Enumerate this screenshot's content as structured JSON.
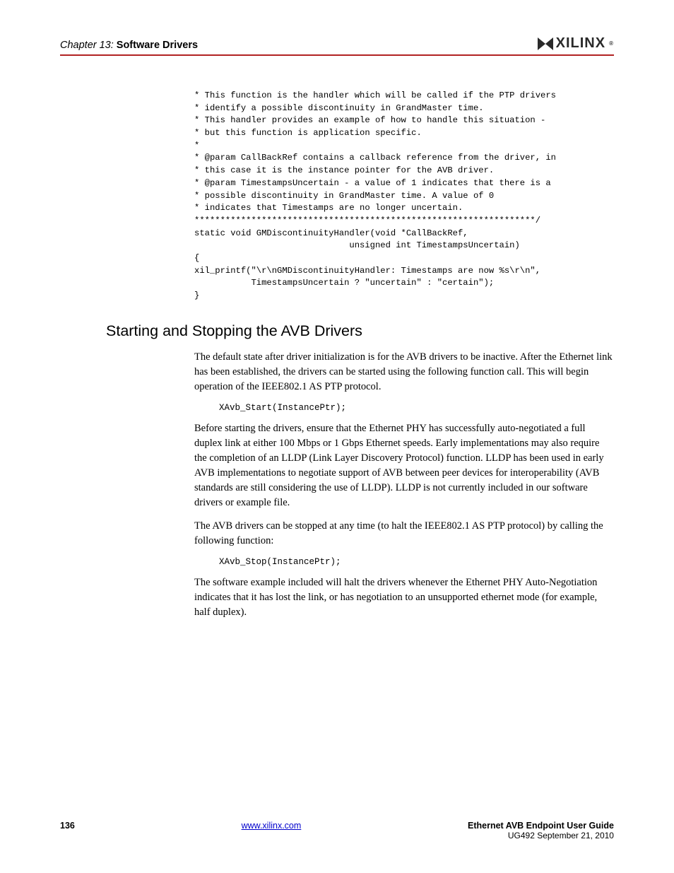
{
  "header": {
    "chapter_prefix": "Chapter 13:",
    "chapter_title": "Software Drivers",
    "logo_text": "XILINX"
  },
  "code_block_1": "* This function is the handler which will be called if the PTP drivers\n* identify a possible discontinuity in GrandMaster time.\n* This handler provides an example of how to handle this situation -\n* but this function is application specific.\n*\n* @param CallBackRef contains a callback reference from the driver, in\n* this case it is the instance pointer for the AVB driver.\n* @param TimestampsUncertain - a value of 1 indicates that there is a\n* possible discontinuity in GrandMaster time. A value of 0\n* indicates that Timestamps are no longer uncertain.\n******************************************************************/\nstatic void GMDiscontinuityHandler(void *CallBackRef,\n                              unsigned int TimestampsUncertain)\n{\nxil_printf(\"\\r\\nGMDiscontinuityHandler: Timestamps are now %s\\r\\n\",\n           TimestampsUncertain ? \"uncertain\" : \"certain\");\n}",
  "section_heading": "Starting and Stopping the AVB Drivers",
  "paragraphs": {
    "p1": "The default state after driver initialization is for the AVB drivers to be inactive. After the Ethernet link has been established, the drivers can be started using the following function call. This will begin operation of the IEEE802.1 AS PTP protocol.",
    "p2": "Before starting the drivers, ensure that the Ethernet PHY has successfully auto-negotiated a full duplex link at either 100 Mbps or 1 Gbps Ethernet speeds. Early implementations may also require the completion of an LLDP (Link Layer Discovery Protocol) function. LLDP has been used in early AVB implementations to negotiate support of AVB between peer devices for interoperability (AVB standards are still considering the use of LLDP). LLDP is not currently included in our software drivers or example file.",
    "p3": "The AVB drivers can be stopped at any time (to halt the IEEE802.1 AS PTP protocol) by calling the following function:",
    "p4": "The software example included will halt the drivers whenever the Ethernet PHY Auto-Negotiation indicates that it has lost the link, or has negotiation to an unsupported ethernet mode (for example, half duplex)."
  },
  "code_inline_1": "XAvb_Start(InstancePtr);",
  "code_inline_2": "XAvb_Stop(InstancePtr);",
  "footer": {
    "page": "136",
    "link": "www.xilinx.com",
    "title": "Ethernet AVB Endpoint User Guide",
    "sub": "UG492 September 21, 2010"
  }
}
